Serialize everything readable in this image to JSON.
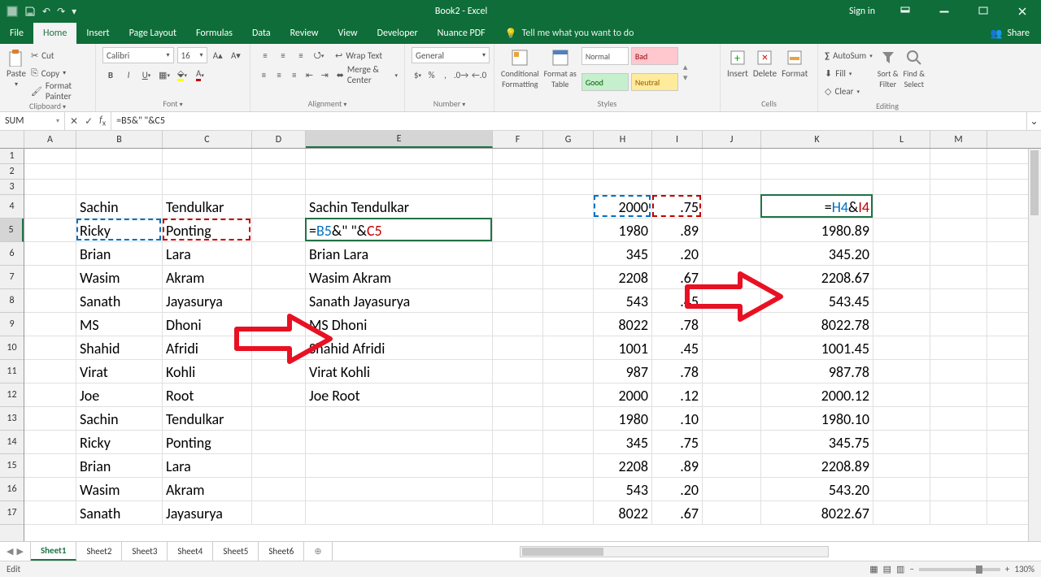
{
  "titlebar": {
    "doc": "Book2 - Excel",
    "signin": "Sign in"
  },
  "tabs": [
    "File",
    "Home",
    "Insert",
    "Page Layout",
    "Formulas",
    "Data",
    "Review",
    "View",
    "Developer",
    "Nuance PDF"
  ],
  "tell_me": "Tell me what you want to do",
  "share": "Share",
  "ribbon": {
    "clipboard": {
      "label": "Clipboard",
      "paste": "Paste",
      "cut": "Cut",
      "copy": "Copy",
      "fp": "Format Painter"
    },
    "font": {
      "label": "Font",
      "name": "Calibri",
      "size": "16"
    },
    "alignment": {
      "label": "Alignment",
      "wrap": "Wrap Text",
      "merge": "Merge & Center"
    },
    "number": {
      "label": "Number",
      "format": "General"
    },
    "styles": {
      "label": "Styles",
      "cf": "Conditional\nFormatting",
      "fat": "Format as\nTable",
      "normal": "Normal",
      "bad": "Bad",
      "good": "Good",
      "neutral": "Neutral"
    },
    "cells": {
      "label": "Cells",
      "insert": "Insert",
      "delete": "Delete",
      "format": "Format"
    },
    "editing": {
      "label": "Editing",
      "autosum": "AutoSum",
      "fill": "Fill",
      "clear": "Clear",
      "sort": "Sort &\nFilter",
      "find": "Find &\nSelect"
    }
  },
  "namebox": "SUM",
  "formula": "=B5&\" \"&C5",
  "columns": [
    "A",
    "B",
    "C",
    "D",
    "E",
    "F",
    "G",
    "H",
    "I",
    "J",
    "K",
    "L",
    "M"
  ],
  "rows": [
    1,
    2,
    3,
    4,
    5,
    6,
    7,
    8,
    9,
    10,
    11,
    12,
    13,
    14,
    15,
    16,
    17
  ],
  "data": {
    "B": {
      "4": "Sachin",
      "5": "Ricky",
      "6": "Brian",
      "7": "Wasim",
      "8": "Sanath",
      "9": "MS",
      "10": "Shahid",
      "11": "Virat",
      "12": "Joe",
      "13": "Sachin",
      "14": "Ricky",
      "15": "Brian",
      "16": "Wasim",
      "17": "Sanath"
    },
    "C": {
      "4": "Tendulkar",
      "5": "Ponting",
      "6": "Lara",
      "7": "Akram",
      "8": "Jayasurya",
      "9": "Dhoni",
      "10": "Afridi",
      "11": "Kohli",
      "12": "Root",
      "13": "Tendulkar",
      "14": "Ponting",
      "15": "Lara",
      "16": "Akram",
      "17": "Jayasurya"
    },
    "E": {
      "4": "Sachin  Tendulkar",
      "5": "=B5&\" \"&C5",
      "6": "Brian Lara",
      "7": "Wasim  Akram",
      "8": "Sanath  Jayasurya",
      "9": "MS Dhoni",
      "10": "Shahid Afridi",
      "11": "Virat Kohli",
      "12": "Joe  Root"
    },
    "H": {
      "4": "2000",
      "5": "1980",
      "6": "345",
      "7": "2208",
      "8": "543",
      "9": "8022",
      "10": "1001",
      "11": "987",
      "12": "2000",
      "13": "1980",
      "14": "345",
      "15": "2208",
      "16": "543",
      "17": "8022"
    },
    "I": {
      "4": ".75",
      "5": ".89",
      "6": ".20",
      "7": ".67",
      "8": ".45",
      "9": ".78",
      "10": ".45",
      "11": ".78",
      "12": ".12",
      "13": ".10",
      "14": ".75",
      "15": ".89",
      "16": ".20",
      "17": ".67"
    },
    "K": {
      "4": "=H4&I4",
      "5": "1980.89",
      "6": "345.20",
      "7": "2208.67",
      "8": "543.45",
      "9": "8022.78",
      "10": "1001.45",
      "11": "987.78",
      "12": "2000.12",
      "13": "1980.10",
      "14": "345.75",
      "15": "2208.89",
      "16": "543.20",
      "17": "8022.67"
    }
  },
  "sheets": [
    "Sheet1",
    "Sheet2",
    "Sheet3",
    "Sheet4",
    "Sheet5",
    "Sheet6"
  ],
  "status": {
    "mode": "Edit",
    "zoom": "130%"
  }
}
